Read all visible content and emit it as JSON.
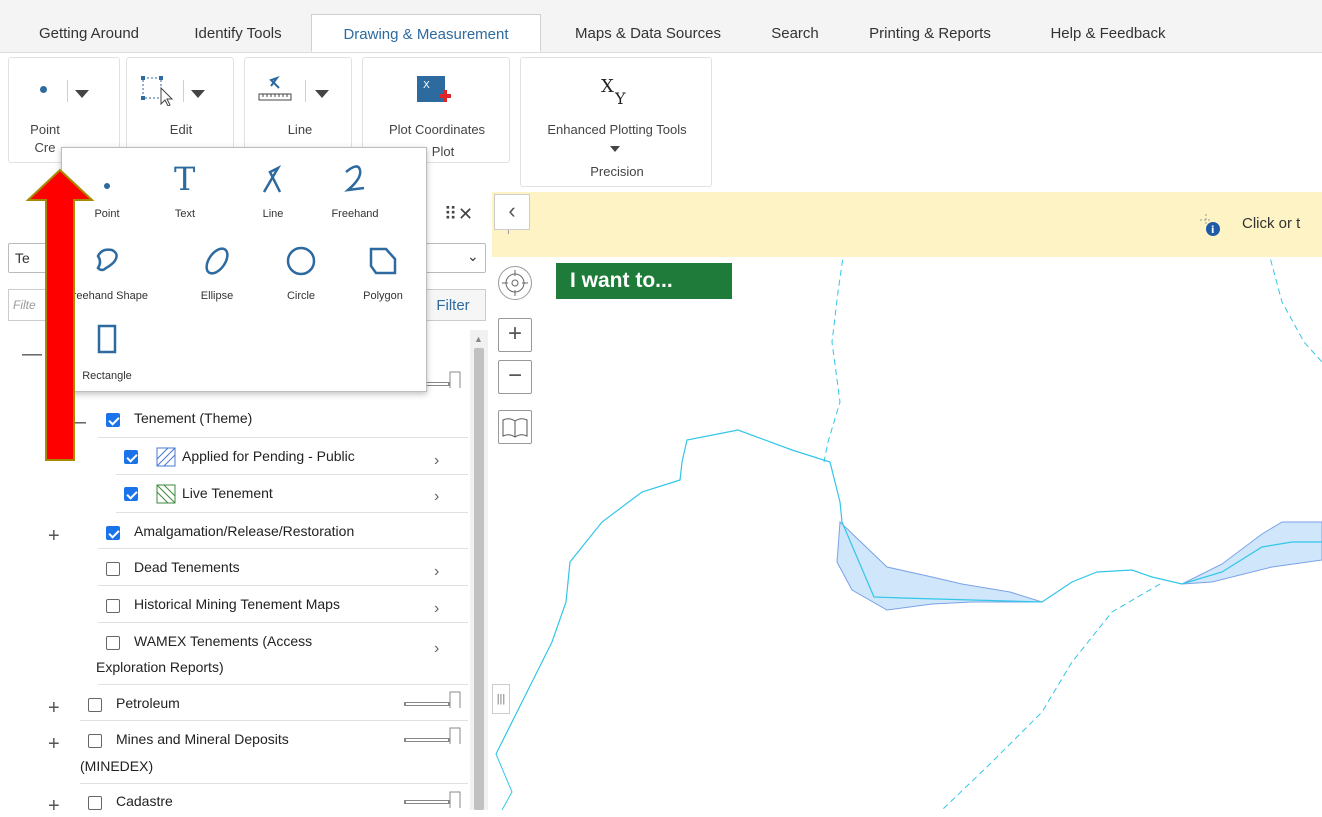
{
  "tabs": [
    {
      "label": "Getting Around"
    },
    {
      "label": "Identify Tools"
    },
    {
      "label": "Drawing & Measurement"
    },
    {
      "label": "Maps & Data Sources"
    },
    {
      "label": "Search"
    },
    {
      "label": "Printing & Reports"
    },
    {
      "label": "Help & Feedback"
    }
  ],
  "ribbon": {
    "point_label": "Point",
    "point_sub": "Cre",
    "edit_label": "Edit",
    "line_label": "Line",
    "plot_label": "Plot Coordinates",
    "plot_sub": "Plot",
    "enhanced_label": "Enhanced Plotting Tools",
    "enhanced_sub": "Precision"
  },
  "popup": {
    "tools": [
      {
        "label": "Point"
      },
      {
        "label": "Text"
      },
      {
        "label": "Line"
      },
      {
        "label": "Freehand"
      },
      {
        "label": "Freehand Shape"
      },
      {
        "label": "Ellipse"
      },
      {
        "label": "Circle"
      },
      {
        "label": "Polygon"
      },
      {
        "label": "Rectangle"
      }
    ]
  },
  "panel": {
    "select_value": "Te",
    "filter_placeholder": "Filte",
    "filter_button": "Filter",
    "layers": [
      {
        "label": "Tenement (Theme)"
      },
      {
        "label": "Applied for Pending - Public"
      },
      {
        "label": "Live Tenement"
      },
      {
        "label": "Amalgamation/Release/Restoration"
      },
      {
        "label": "Dead Tenements"
      },
      {
        "label": "Historical Mining Tenement Maps"
      },
      {
        "label": "WAMEX Tenements (Access"
      },
      {
        "label": "Exploration Reports)"
      },
      {
        "label": "Petroleum"
      },
      {
        "label": "Mines and Mineral Deposits"
      },
      {
        "label": "(MINEDEX)"
      },
      {
        "label": "Cadastre"
      }
    ]
  },
  "map": {
    "banner_text": "Click or t",
    "i_want_to": "I want to..."
  },
  "colors": {
    "accent": "#2d6a9f",
    "iwant": "#1e7b3a",
    "banner": "#fdf3c4",
    "arrow": "#ff0000"
  }
}
